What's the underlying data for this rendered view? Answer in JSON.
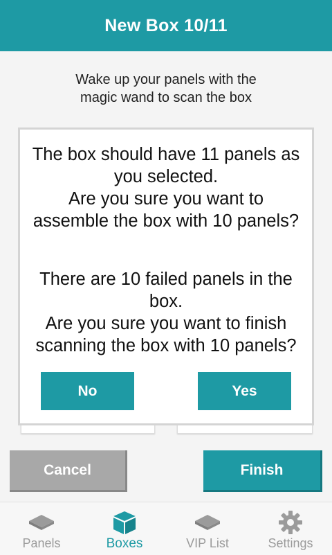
{
  "header": {
    "title": "New Box 10/11"
  },
  "instruction": "Wake up your panels with the\nmagic wand to scan the box",
  "dialog": {
    "message1": "The box should have 11 panels as you selected.\nAre you sure you want to assemble the box with 10 panels?",
    "message2": "There are 10 failed panels in the box.\nAre you sure you want to finish scanning the box with 10 panels?",
    "no_label": "No",
    "yes_label": "Yes"
  },
  "actions": {
    "cancel_label": "Cancel",
    "finish_label": "Finish"
  },
  "nav": {
    "items": [
      {
        "label": "Panels",
        "icon": "panels-icon"
      },
      {
        "label": "Boxes",
        "icon": "box-icon",
        "active": true
      },
      {
        "label": "VIP List",
        "icon": "vip-list-icon"
      },
      {
        "label": "Settings",
        "icon": "gear-icon"
      }
    ]
  },
  "colors": {
    "accent": "#1e9aa4",
    "cancel": "#a8a8a8",
    "inactive": "#9b9b9b"
  }
}
